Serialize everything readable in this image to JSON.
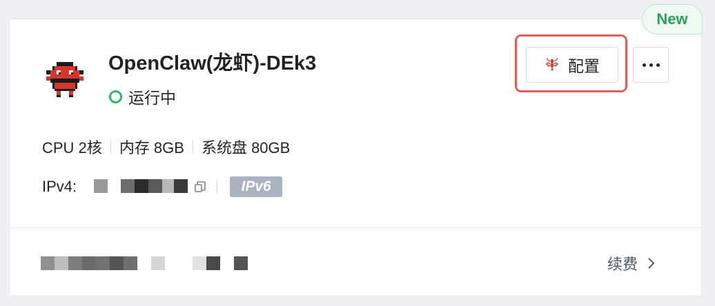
{
  "badge": {
    "label": "New"
  },
  "instance": {
    "title": "OpenClaw(龙虾)-DEk3",
    "status": "运行中",
    "status_color": "#2fb863",
    "logo_icon": "red-crab-pixel-icon"
  },
  "actions": {
    "config_label": "配置",
    "config_icon": "lobster-icon",
    "more_icon": "ellipsis-icon"
  },
  "specs": {
    "cpu": "CPU 2核",
    "memory": "内存 8GB",
    "disk": "系统盘 80GB"
  },
  "network": {
    "ipv4_label": "IPv4:",
    "ipv6_badge": "IPv6",
    "copy_icon": "copy-icon"
  },
  "footer": {
    "renew_label": "续费",
    "renew_icon": "chevron-right-icon"
  },
  "colors": {
    "accent_red": "#e85b5b",
    "badge_green": "#27a35a"
  }
}
